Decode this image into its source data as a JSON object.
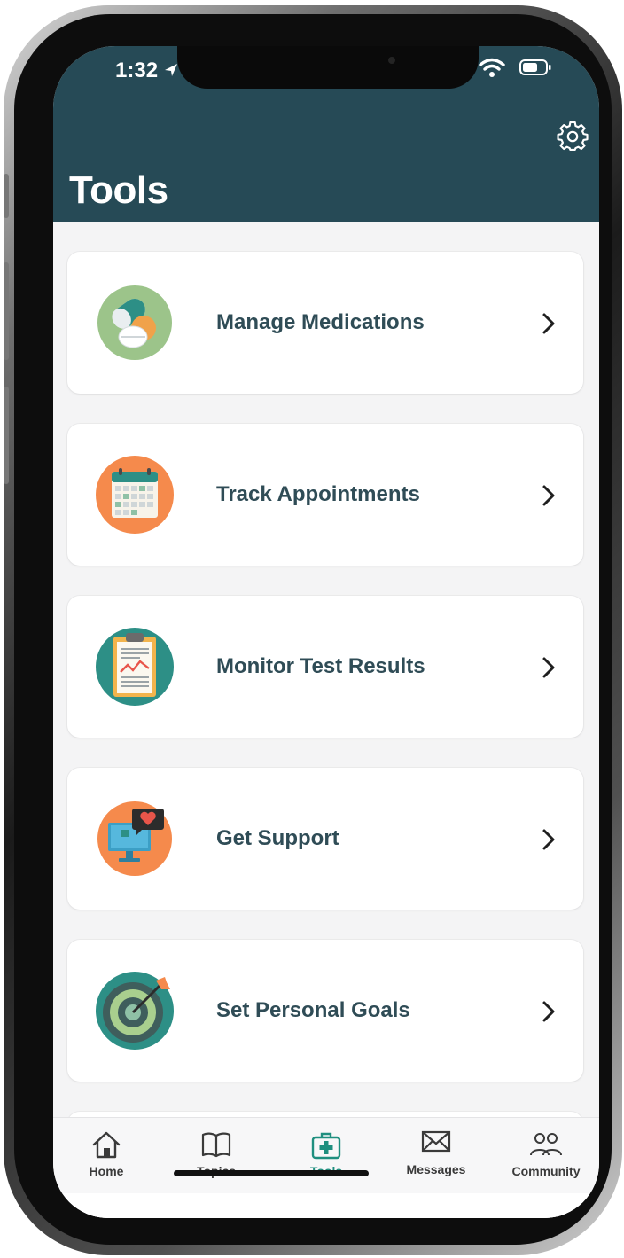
{
  "status_bar": {
    "time": "1:32"
  },
  "header": {
    "title": "Tools",
    "settings_icon": "gear-icon",
    "background_color": "#264a56"
  },
  "tools": [
    {
      "label": "Manage Medications",
      "icon": "pills-icon"
    },
    {
      "label": "Track Appointments",
      "icon": "calendar-icon"
    },
    {
      "label": "Monitor Test Results",
      "icon": "clipboard-chart-icon"
    },
    {
      "label": "Get Support",
      "icon": "monitor-heart-icon"
    },
    {
      "label": "Set Personal Goals",
      "icon": "target-icon"
    }
  ],
  "tabbar": {
    "active_color": "#1f8f7f",
    "items": [
      {
        "label": "Home",
        "icon": "home-icon"
      },
      {
        "label": "Topics",
        "icon": "book-icon"
      },
      {
        "label": "Tools",
        "icon": "medical-kit-icon",
        "active": true
      },
      {
        "label": "Messages",
        "icon": "envelope-icon"
      },
      {
        "label": "Community",
        "icon": "people-icon"
      }
    ]
  }
}
